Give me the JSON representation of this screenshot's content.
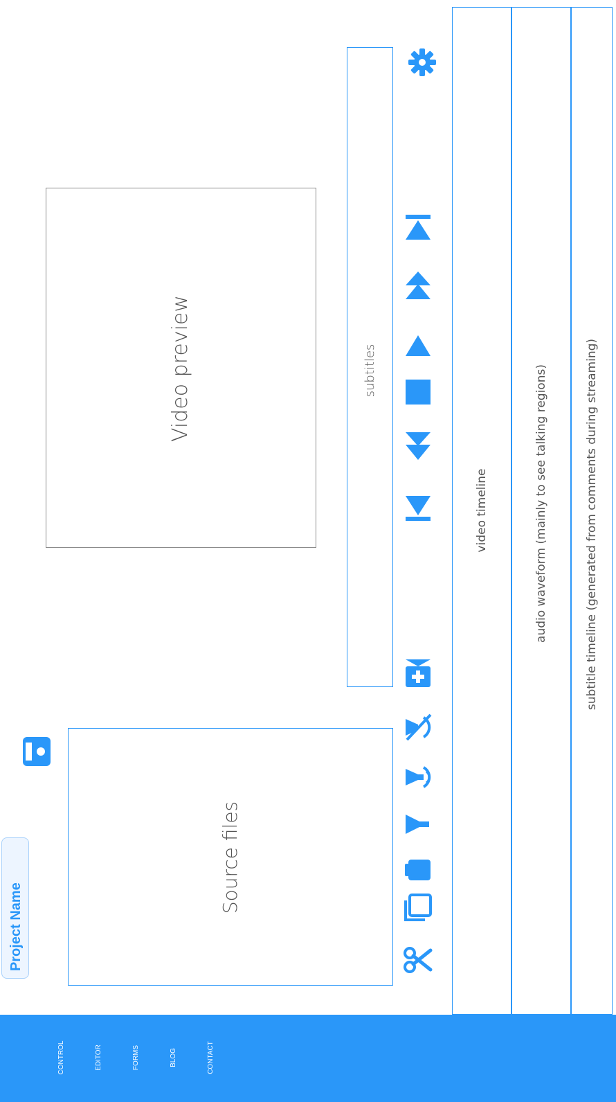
{
  "project": {
    "name": "Project Name"
  },
  "nav": {
    "items": [
      "CONTROL",
      "EDITOR",
      "FORMS",
      "BLOG",
      "CONTACT"
    ]
  },
  "panels": {
    "source_files": "Source files",
    "video_preview": "Video preview",
    "subtitles": "subtitles"
  },
  "timelines": {
    "video": "video timeline",
    "audio": "audio waveform (mainly to see talking regions)",
    "subtitle": "subtitle timeline (generated from comments during streaming)"
  },
  "toolbar": {
    "icons": [
      "cut-icon",
      "copy-icon",
      "delete-icon",
      "mute-icon",
      "speaker-icon",
      "hide-icon",
      "add-clip-icon",
      "skip-start-icon",
      "rewind-icon",
      "stop-icon",
      "play-icon",
      "fast-forward-icon",
      "skip-end-icon",
      "settings-icon"
    ]
  },
  "colors": {
    "accent": "#2a97f9",
    "nav_bg": "#2a97f9",
    "panel_border": "#2a97f9"
  }
}
